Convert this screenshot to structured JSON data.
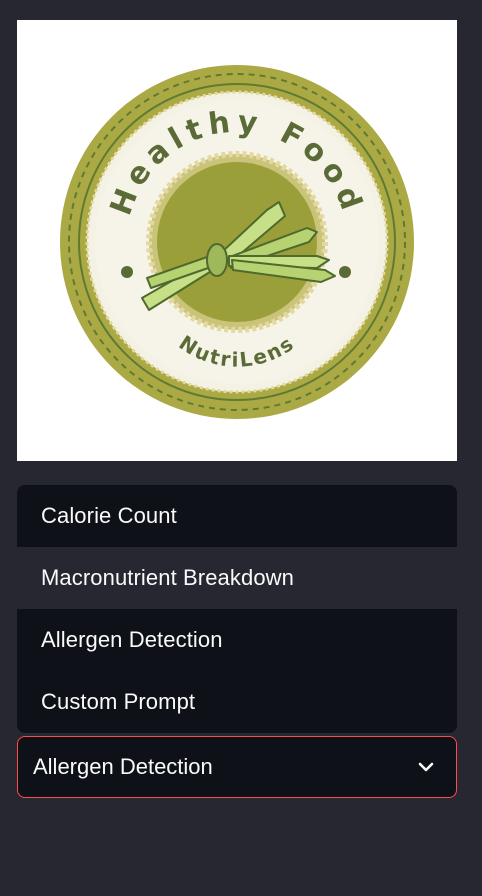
{
  "logo": {
    "top_text": "Healthy Food",
    "bottom_text": "NutriLens",
    "colors": {
      "outer": "#aaa944",
      "rim_light": "#f2f1e2",
      "center": "#9a9f3a",
      "text": "#5b6b37",
      "veg": "#c7df86"
    }
  },
  "dropdown": {
    "options": [
      {
        "label": "Calorie Count"
      },
      {
        "label": "Macronutrient Breakdown"
      },
      {
        "label": "Allergen Detection"
      },
      {
        "label": "Custom Prompt"
      }
    ],
    "highlighted": "Macronutrient Breakdown"
  },
  "select": {
    "value": "Allergen Detection",
    "icon": "chevron-down-icon"
  },
  "colors": {
    "background": "#262730",
    "menu_bg": "#0e1117",
    "focus_border": "#ff4b4b",
    "text": "#fafafa"
  }
}
